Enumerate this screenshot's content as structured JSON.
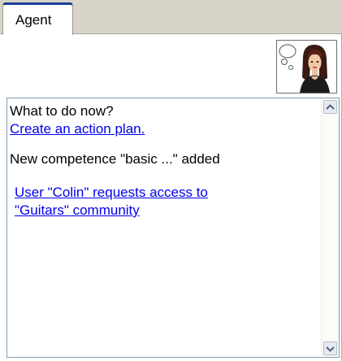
{
  "tabs": [
    {
      "label": "Agent",
      "active": true
    }
  ],
  "agent": {
    "avatar_icon": "agent-thinking-avatar"
  },
  "messages": {
    "prompt": "What to do now?",
    "action_link": "Create an action plan.",
    "notice": "New competence \"basic ...\" added",
    "request_link_line1": "User \"Colin\" requests access to",
    "request_link_line2": "\"Guitars\" community"
  },
  "colors": {
    "tab_accent": "#1b3f96",
    "link": "#0000ee",
    "tab_strip_bg": "#d8d4c8"
  }
}
